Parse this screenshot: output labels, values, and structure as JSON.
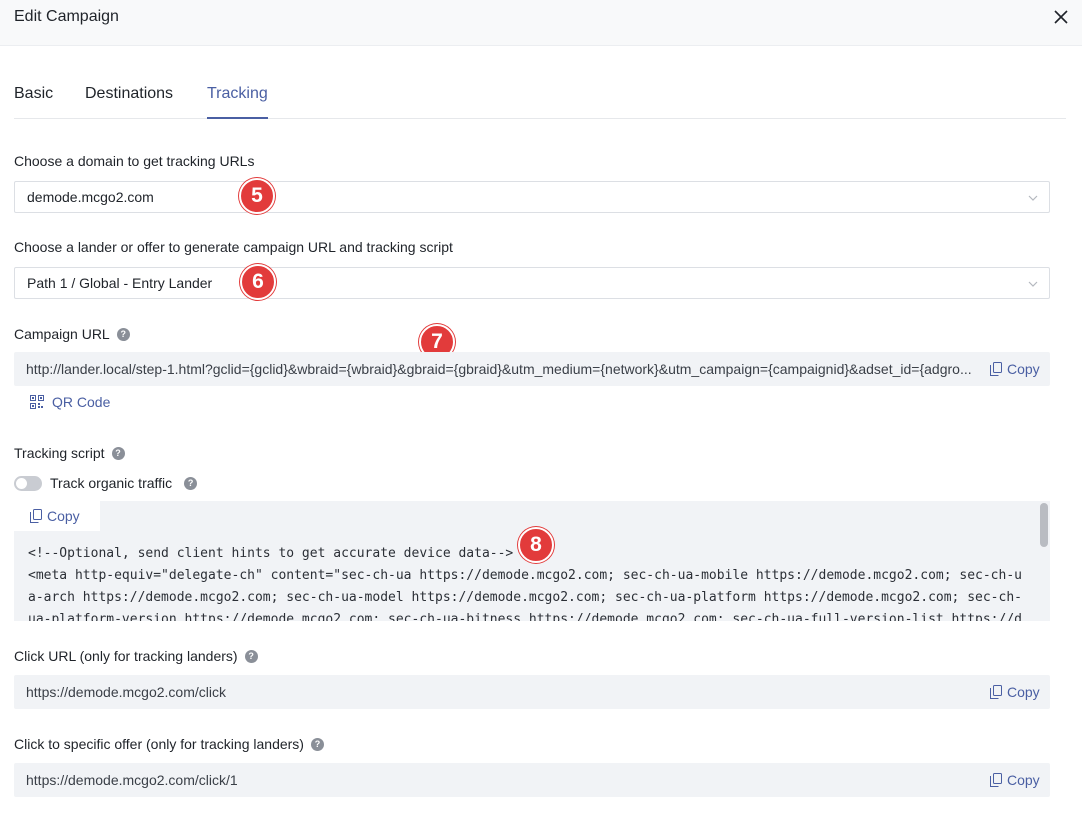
{
  "header": {
    "title": "Edit Campaign"
  },
  "tabs": [
    {
      "label": "Basic"
    },
    {
      "label": "Destinations"
    },
    {
      "label": "Tracking",
      "active": true
    }
  ],
  "domain": {
    "label": "Choose a domain to get tracking URLs",
    "value": "demode.mcgo2.com"
  },
  "lander": {
    "label": "Choose a lander or offer to generate campaign URL and tracking script",
    "value": "Path 1 / Global - Entry Lander"
  },
  "campaign_url": {
    "label": "Campaign URL",
    "value": "http://lander.local/step-1.html?gclid={gclid}&wbraid={wbraid}&gbraid={gbraid}&utm_medium={network}&utm_campaign={campaignid}&adset_id={adgro...",
    "copy_label": "Copy",
    "qr_label": "QR Code"
  },
  "tracking_script": {
    "label": "Tracking script",
    "toggle_label": "Track organic traffic",
    "toggle_on": false,
    "copy_label": "Copy",
    "code": "<!--Optional, send client hints to get accurate device data-->\n<meta http-equiv=\"delegate-ch\" content=\"sec-ch-ua https://demode.mcgo2.com; sec-ch-ua-mobile https://demode.mcgo2.com; sec-ch-ua-arch https://demode.mcgo2.com; sec-ch-ua-model https://demode.mcgo2.com; sec-ch-ua-platform https://demode.mcgo2.com; sec-ch-ua-platform-version https://demode.mcgo2.com; sec-ch-ua-bitness https://demode.mcgo2.com; sec-ch-ua-full-version-list https://demode."
  },
  "click_url": {
    "label": "Click URL (only for tracking landers)",
    "value": "https://demode.mcgo2.com/click",
    "copy_label": "Copy"
  },
  "specific_offer": {
    "label": "Click to specific offer (only for tracking landers)",
    "value": "https://demode.mcgo2.com/click/1",
    "copy_label": "Copy"
  },
  "annotations": [
    "5",
    "6",
    "7",
    "8"
  ],
  "colors": {
    "accent": "#4a5fa3",
    "badge": "#e23b3b",
    "field_bg": "#f1f3f6"
  },
  "icons": {
    "close": "close-icon",
    "chevron": "chevron-down-icon",
    "copy": "copy-icon",
    "qr": "qr-code-icon",
    "help": "help-icon"
  }
}
